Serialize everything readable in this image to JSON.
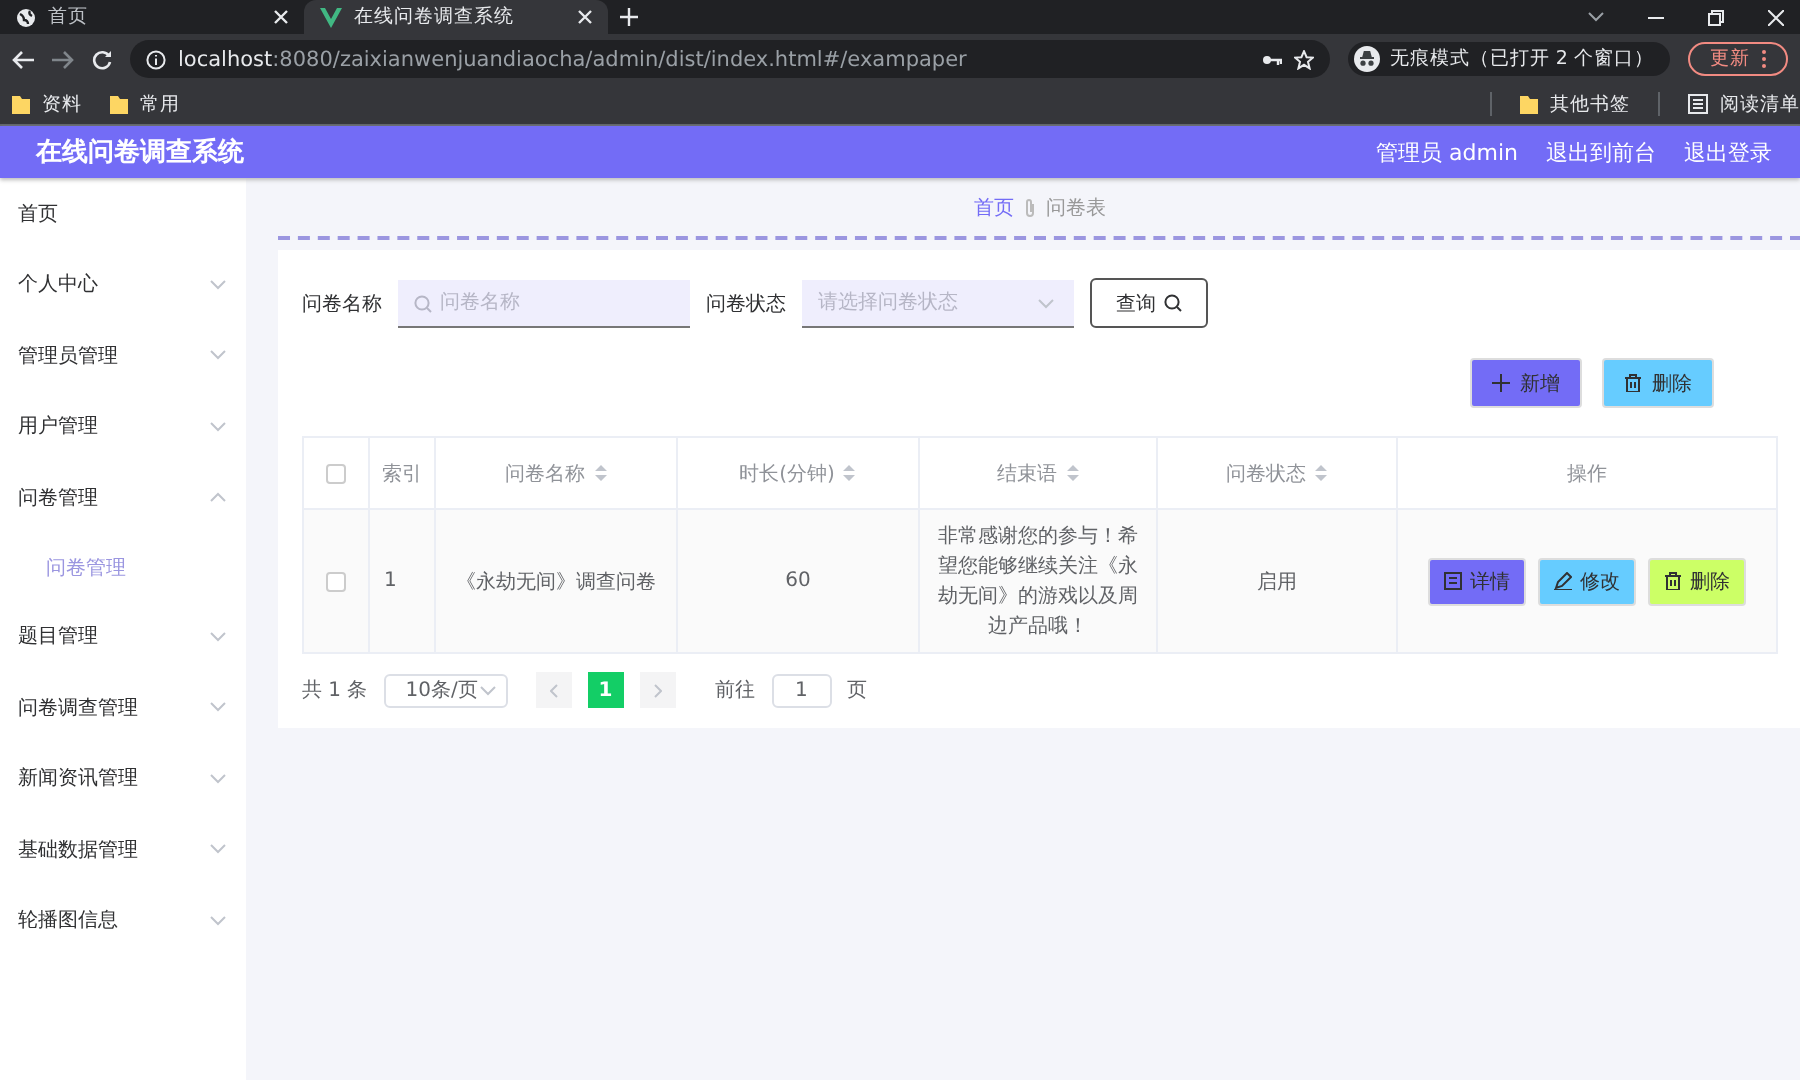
{
  "browser": {
    "tabs": [
      {
        "title": "首页",
        "selected": false
      },
      {
        "title": "在线问卷调查系统",
        "selected": true
      }
    ],
    "url_host": "localhost",
    "url_path": ":8080/zaixianwenjuandiaocha/admin/dist/index.html#/exampaper",
    "incognito": "无痕模式（已打开 2 个窗口）",
    "update_button": "更新",
    "bookmarks": [
      "资料",
      "常用"
    ],
    "other_bookmarks": "其他书签",
    "reading_list": "阅读清单"
  },
  "header": {
    "title": "在线问卷调查系统",
    "links": [
      "管理员 admin",
      "退出到前台",
      "退出登录"
    ]
  },
  "sidebar": {
    "items": [
      {
        "label": "首页"
      },
      {
        "label": "个人中心",
        "expanded": false
      },
      {
        "label": "管理员管理",
        "expanded": false
      },
      {
        "label": "用户管理",
        "expanded": false
      },
      {
        "label": "问卷管理",
        "expanded": true,
        "children": [
          {
            "label": "问卷管理",
            "selected": true
          }
        ]
      },
      {
        "label": "题目管理",
        "expanded": false
      },
      {
        "label": "问卷调查管理",
        "expanded": false
      },
      {
        "label": "新闻资讯管理",
        "expanded": false
      },
      {
        "label": "基础数据管理",
        "expanded": false
      },
      {
        "label": "轮播图信息",
        "expanded": false
      }
    ]
  },
  "breadcrumb": [
    "首页",
    "问卷表"
  ],
  "filters": [
    {
      "label": "问卷名称",
      "kind": "search",
      "placeholder": "问卷名称"
    },
    {
      "label": "问卷状态",
      "kind": "select",
      "placeholder": "请选择问卷状态"
    }
  ],
  "search_button": "查询",
  "actions": [
    {
      "label": "新增",
      "kind": "add"
    },
    {
      "label": "删除",
      "kind": "delete"
    }
  ],
  "table": {
    "header_checked": false,
    "columns": [
      {
        "label": "索引",
        "sortable": false
      },
      {
        "label": "问卷名称",
        "sortable": true
      },
      {
        "label": "时长(分钟)",
        "sortable": true
      },
      {
        "label": "结束语",
        "sortable": true
      },
      {
        "label": "问卷状态",
        "sortable": true
      },
      {
        "label": "操作",
        "sortable": false
      }
    ],
    "rows": [
      {
        "checked": false,
        "cells": [
          "1",
          "《永劫无间》调查问卷",
          "60",
          "非常感谢您的参与！希望您能够继续关注《永劫无间》的游戏以及周边产品哦！",
          "启用"
        ],
        "buttons": [
          {
            "label": "详情",
            "kind": "detail"
          },
          {
            "label": "修改",
            "kind": "edit"
          },
          {
            "label": "删除",
            "kind": "delete"
          }
        ]
      }
    ]
  },
  "pagination": {
    "total": "共 1 条",
    "page_size": "10条/页",
    "pages": [
      {
        "label": "1",
        "selected": true
      }
    ],
    "goto_label": "前往",
    "goto_value": "1",
    "page_unit": "页"
  }
}
